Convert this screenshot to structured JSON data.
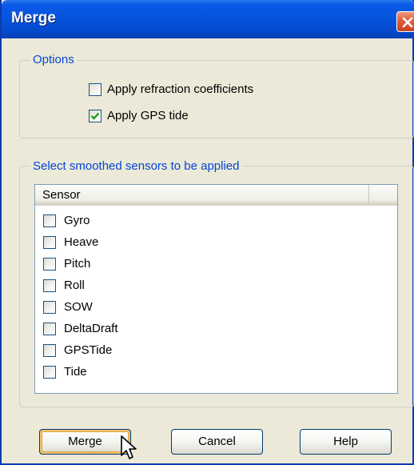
{
  "window": {
    "title": "Merge"
  },
  "options_group": {
    "title": "Options",
    "checkboxes": [
      {
        "label": "Apply refraction coefficients",
        "checked": false
      },
      {
        "label": "Apply GPS tide",
        "checked": true
      }
    ]
  },
  "sensors_group": {
    "title": "Select smoothed sensors to be applied",
    "column_header": "Sensor",
    "sensors": [
      {
        "label": "Gyro",
        "checked": false
      },
      {
        "label": "Heave",
        "checked": false
      },
      {
        "label": "Pitch",
        "checked": false
      },
      {
        "label": "Roll",
        "checked": false
      },
      {
        "label": "SOW",
        "checked": false
      },
      {
        "label": "DeltaDraft",
        "checked": false
      },
      {
        "label": "GPSTide",
        "checked": false
      },
      {
        "label": "Tide",
        "checked": false
      }
    ]
  },
  "buttons": {
    "merge": "Merge",
    "cancel": "Cancel",
    "help": "Help"
  },
  "colors": {
    "title_bar": "#0653dd",
    "group_title": "#0046d5",
    "check_mark": "#21a121",
    "close_button": "#e2603e"
  }
}
